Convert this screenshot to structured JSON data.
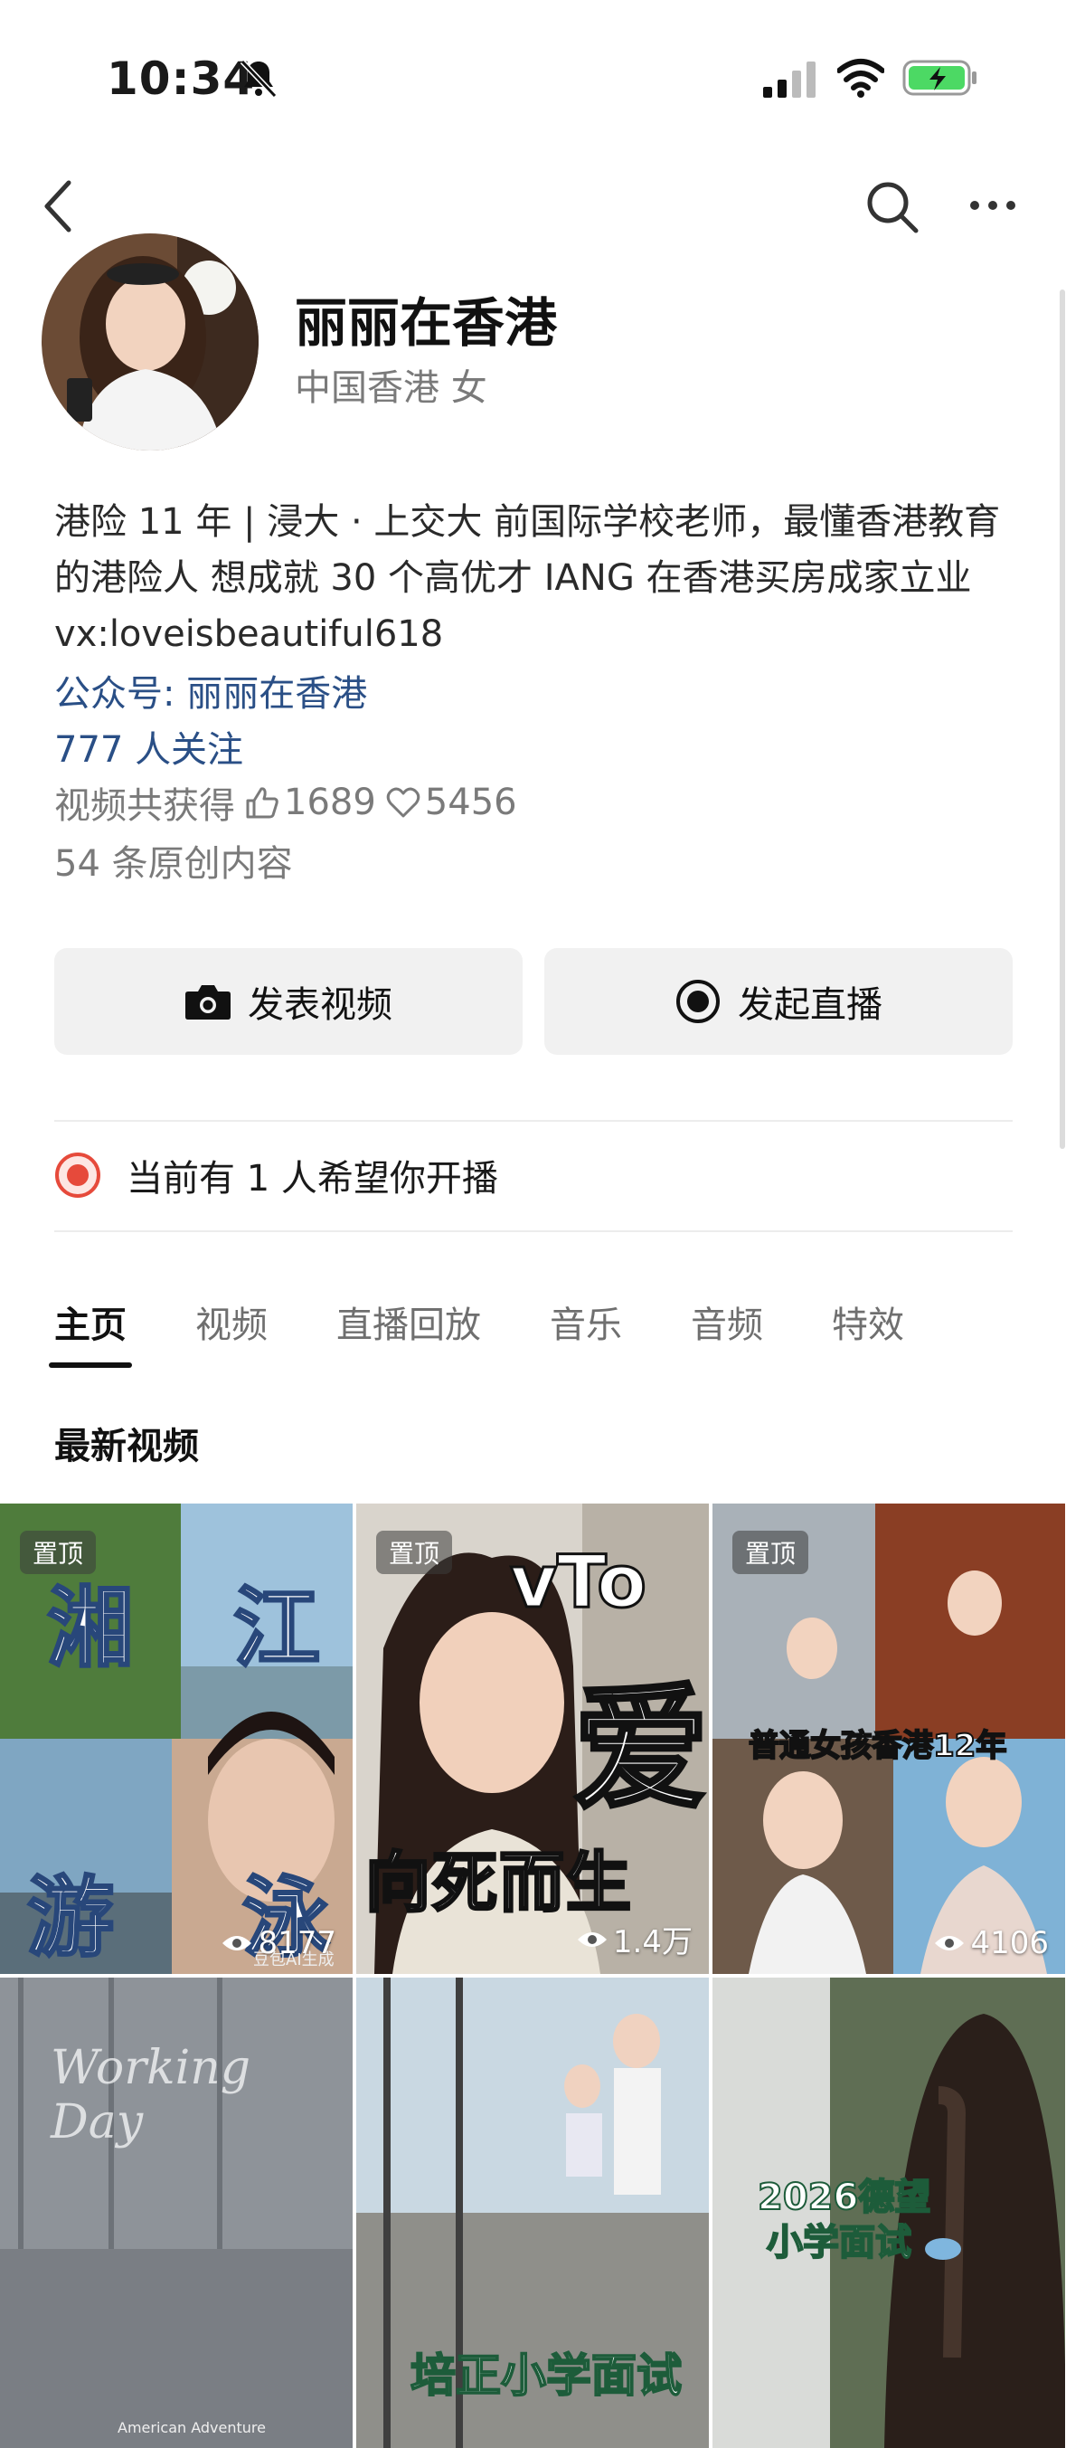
{
  "status": {
    "time": "10:34"
  },
  "profile": {
    "name": "丽丽在香港",
    "location_gender": "中国香港 女",
    "bio": "港险 11 年 | 浸大 · 上交大 前国际学校老师，最懂香港教育的港险人 想成就 30 个高优才 IANG 在香港买房成家立业 vx:loveisbeautiful618",
    "official_account": "公众号: 丽丽在香港",
    "followers": "777 人关注",
    "stats_label": "视频共获得",
    "likes": "1689",
    "hearts": "5456",
    "original_count": "54 条原创内容"
  },
  "actions": {
    "post_video": "发表视频",
    "start_live": "发起直播"
  },
  "live_hint": "当前有 1 人希望你开播",
  "tabs": [
    "主页",
    "视频",
    "直播回放",
    "音乐",
    "音频",
    "特效"
  ],
  "section_title": "最新视频",
  "videos": [
    {
      "pinned": "置顶",
      "views": "8177",
      "overlay": [
        "湘",
        "江",
        "游",
        "泳"
      ],
      "caption": "豆包AI生成"
    },
    {
      "pinned": "置顶",
      "views": "1.4万",
      "overlay": [
        "vTo",
        "爱",
        "向死而生"
      ]
    },
    {
      "pinned": "置顶",
      "views": "4106",
      "overlay": [
        "普通女孩香港12年"
      ]
    },
    {
      "overlay": [
        "Working Day"
      ],
      "caption": "American Adventure"
    },
    {
      "overlay": [
        "培正小学面试"
      ]
    },
    {
      "overlay": [
        "2026德望",
        "小学面试"
      ]
    }
  ],
  "colors": {
    "link": "#2a4f86",
    "live_red": "#e64a3b",
    "battery_green": "#4cd964"
  },
  "icons": [
    "chevron-left-icon",
    "search-icon",
    "more-icon",
    "camera-icon",
    "live-record-icon",
    "thumbs-up-icon",
    "heart-icon",
    "eye-icon"
  ]
}
